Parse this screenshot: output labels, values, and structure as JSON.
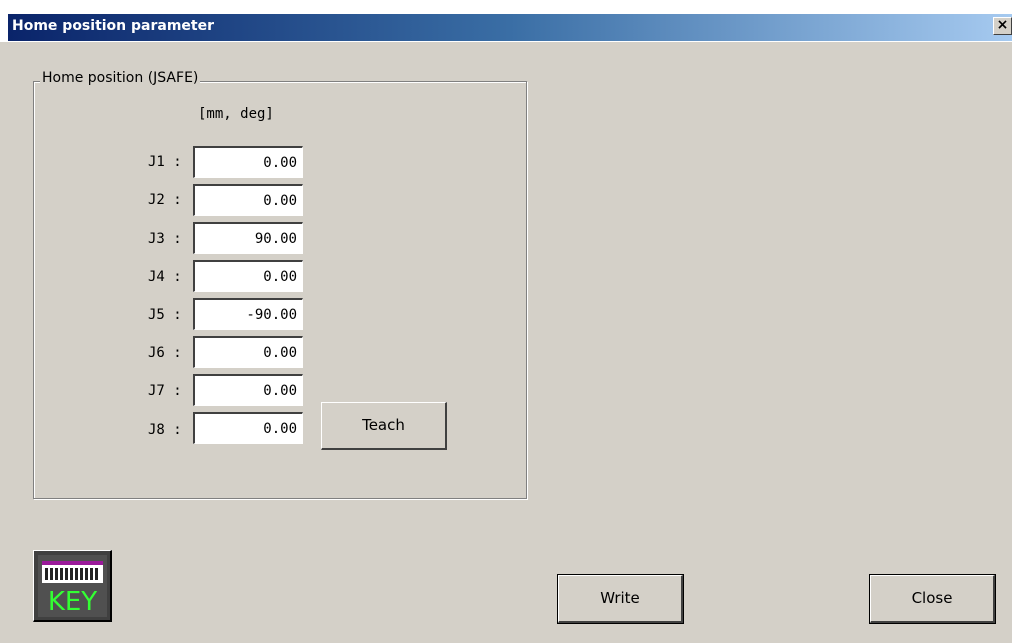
{
  "window": {
    "title": "Home position parameter",
    "close_glyph": "×"
  },
  "group": {
    "label": "Home position (JSAFE)",
    "units": "[mm, deg]"
  },
  "joints": [
    {
      "label": "J1 :",
      "value": "0.00"
    },
    {
      "label": "J2 :",
      "value": "0.00"
    },
    {
      "label": "J3 :",
      "value": "90.00"
    },
    {
      "label": "J4 :",
      "value": "0.00"
    },
    {
      "label": "J5 :",
      "value": "-90.00"
    },
    {
      "label": "J6 :",
      "value": "0.00"
    },
    {
      "label": "J7 :",
      "value": "0.00"
    },
    {
      "label": "J8 :",
      "value": "0.00"
    }
  ],
  "buttons": {
    "teach": "Teach",
    "write": "Write",
    "close": "Close",
    "key": "KEY"
  },
  "icons": {
    "keyboard": "keyboard-icon"
  },
  "colors": {
    "window_bg": "#d4d0c8",
    "title_start": "#0a246a",
    "title_end": "#a6caf0",
    "key_text": "#33ff33"
  }
}
